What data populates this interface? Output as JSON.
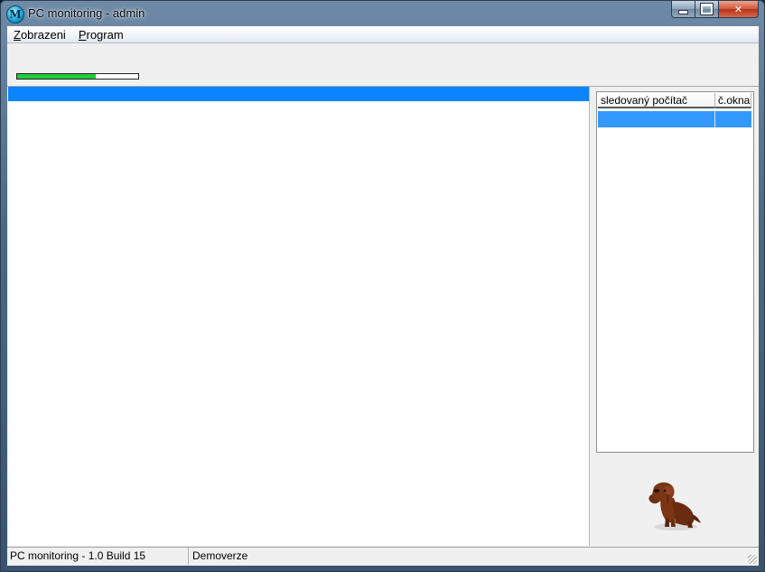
{
  "window": {
    "title": "PC monitoring - admin",
    "icon": "monitoring-app-icon"
  },
  "caption_buttons": {
    "minimize": "minimize-icon",
    "maximize": "maximize-icon",
    "close_glyph": "✕"
  },
  "menu": {
    "items": [
      {
        "accel": "Z",
        "rest": "obrazeni"
      },
      {
        "accel": "P",
        "rest": "rogram"
      }
    ]
  },
  "toolbar": {
    "progress_percent": 65,
    "progress_color": "#22cc3a"
  },
  "main": {
    "selected_row_color": "#0a84ff"
  },
  "grid": {
    "columns": [
      "sledovaný počítač",
      "č.okna"
    ],
    "selected_row_color": "#3399ff"
  },
  "mascot": {
    "icon": "dachshund-dog-icon"
  },
  "statusbar": {
    "panel1": "PC monitoring - 1.0  Build 15",
    "panel2": "Demoverze"
  }
}
